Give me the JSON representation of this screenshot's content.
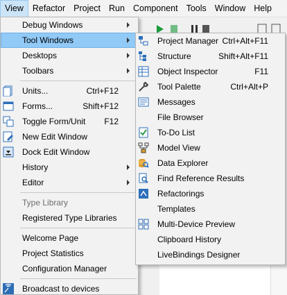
{
  "menubar": {
    "items": [
      "View",
      "Refactor",
      "Project",
      "Run",
      "Component",
      "Tools",
      "Window",
      "Help"
    ]
  },
  "view_menu": {
    "items": [
      {
        "label": "Debug Windows",
        "submenu": true
      },
      {
        "label": "Tool Windows",
        "submenu": true,
        "highlight": true
      },
      {
        "label": "Desktops",
        "submenu": true
      },
      {
        "label": "Toolbars",
        "submenu": true
      },
      {
        "sep": true
      },
      {
        "label": "Units...",
        "shortcut": "Ctrl+F12",
        "icon": "units-icon"
      },
      {
        "label": "Forms...",
        "shortcut": "Shift+F12",
        "icon": "forms-icon"
      },
      {
        "label": "Toggle Form/Unit",
        "shortcut": "F12",
        "icon": "toggle-form-unit-icon"
      },
      {
        "label": "New Edit Window",
        "icon": "new-edit-window-icon"
      },
      {
        "label": "Dock Edit Window",
        "icon": "dock-edit-window-icon"
      },
      {
        "label": "History",
        "submenu": true
      },
      {
        "label": "Editor",
        "submenu": true
      },
      {
        "sep": true
      },
      {
        "label": "Type Library",
        "disabled": true
      },
      {
        "label": "Registered Type Libraries"
      },
      {
        "sep": true
      },
      {
        "label": "Welcome Page"
      },
      {
        "label": "Project Statistics"
      },
      {
        "label": "Configuration Manager"
      },
      {
        "sep": true
      },
      {
        "label": "Broadcast to devices",
        "icon": "broadcast-icon"
      }
    ]
  },
  "tool_windows_menu": {
    "items": [
      {
        "label": "Project Manager",
        "shortcut": "Ctrl+Alt+F11",
        "icon": "project-manager-icon"
      },
      {
        "label": "Structure",
        "shortcut": "Shift+Alt+F11",
        "icon": "structure-icon"
      },
      {
        "label": "Object Inspector",
        "shortcut": "F11",
        "icon": "object-inspector-icon"
      },
      {
        "label": "Tool Palette",
        "shortcut": "Ctrl+Alt+P",
        "icon": "tool-palette-icon"
      },
      {
        "label": "Messages",
        "icon": "messages-icon"
      },
      {
        "label": "File Browser"
      },
      {
        "label": "To-Do List",
        "icon": "todo-list-icon"
      },
      {
        "label": "Model View",
        "icon": "model-view-icon"
      },
      {
        "label": "Data Explorer",
        "icon": "data-explorer-icon"
      },
      {
        "label": "Find Reference Results",
        "icon": "find-reference-icon"
      },
      {
        "label": "Refactorings",
        "icon": "refactorings-icon"
      },
      {
        "label": "Templates"
      },
      {
        "label": "Multi-Device Preview",
        "icon": "multi-device-preview-icon"
      },
      {
        "label": "Clipboard History"
      },
      {
        "label": "LiveBindings Designer"
      }
    ]
  },
  "colors": {
    "highlight": "#91c9f7",
    "menu_bg": "#f2f2f2",
    "menubar_active": "#cce4f7"
  }
}
